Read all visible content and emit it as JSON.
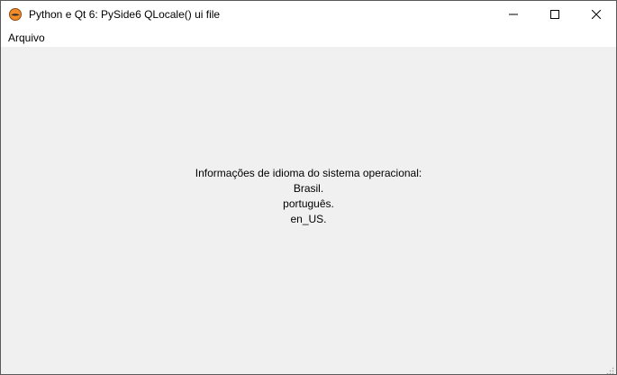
{
  "window": {
    "title": "Python e Qt 6: PySide6 QLocale() ui file",
    "icon": "python-logo-icon",
    "controls": [
      "minimize-icon",
      "maximize-icon",
      "close-icon"
    ]
  },
  "menubar": {
    "items": [
      {
        "label": "Arquivo"
      }
    ]
  },
  "content": {
    "lines": [
      "Informações de idioma do sistema operacional:",
      "Brasil.",
      "português.",
      "en_US."
    ]
  },
  "colors": {
    "titlebar_bg": "#ffffff",
    "client_bg": "#f0f0f0",
    "text": "#000000",
    "icon_orange": "#f28c28"
  }
}
